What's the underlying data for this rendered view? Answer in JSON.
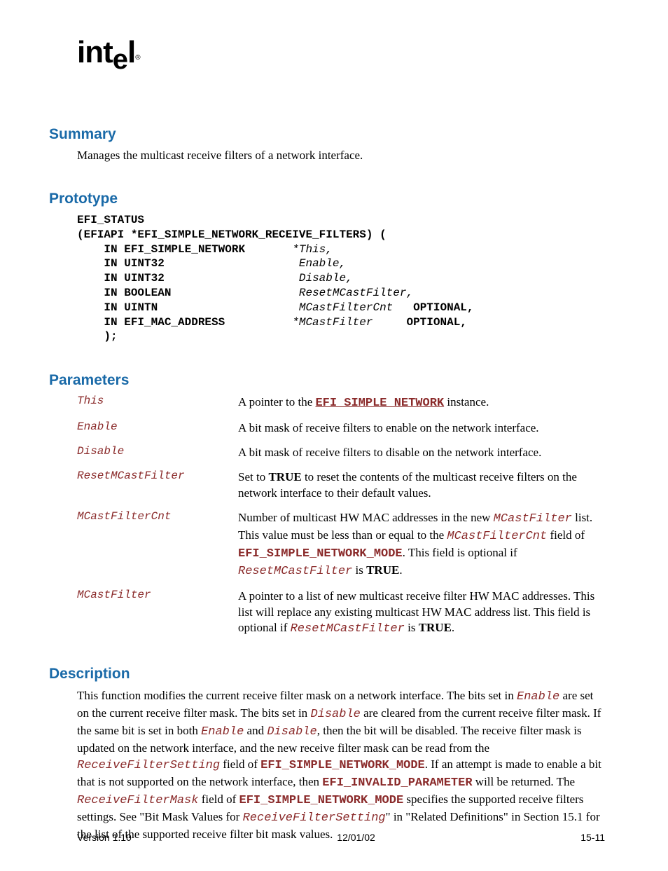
{
  "logo": "intel",
  "summary": {
    "heading": "Summary",
    "text": "Manages the multicast receive filters of a network interface."
  },
  "prototype": {
    "heading": "Prototype",
    "l1": "EFI_STATUS",
    "l2": "(EFIAPI *EFI_SIMPLE_NETWORK_RECEIVE_FILTERS) (",
    "r1a": "    IN EFI_SIMPLE_NETWORK       ",
    "r1b": "*This,",
    "r2a": "    IN UINT32                    ",
    "r2b": "Enable,",
    "r3a": "    IN UINT32                    ",
    "r3b": "Disable,",
    "r4a": "    IN BOOLEAN                   ",
    "r4b": "ResetMCastFilter,",
    "r5a": "    IN UINTN                     ",
    "r5b": "MCastFilterCnt",
    "r5c": "   OPTIONAL,",
    "r6a": "    IN EFI_MAC_ADDRESS          ",
    "r6b": "*MCastFilter",
    "r6c": "     OPTIONAL,",
    "r7": "    );"
  },
  "parameters": {
    "heading": "Parameters",
    "rows": [
      {
        "name": "This"
      },
      {
        "name": "Enable"
      },
      {
        "name": "Disable"
      },
      {
        "name": "ResetMCastFilter"
      },
      {
        "name": "MCastFilterCnt"
      },
      {
        "name": "MCastFilter"
      }
    ],
    "thisDesc": {
      "pre": "A pointer to the ",
      "link": "EFI_SIMPLE_NETWORK",
      "post": " instance."
    },
    "enableDesc": "A bit mask of receive filters to enable on the network interface.",
    "disableDesc": "A bit mask of receive filters to disable on the network interface.",
    "resetDesc": {
      "pre": "Set to ",
      "b1": "TRUE",
      "post": " to reset the contents of the multicast receive filters on the network interface to their default values."
    },
    "cntDesc": {
      "t1": "Number of multicast HW MAC addresses in the new ",
      "i1": "MCastFilter",
      "t2": " list.  This value must be less than or equal to the ",
      "i2": "MCastFilterCnt",
      "t3": " field of ",
      "b1": "EFI_SIMPLE_NETWORK_MODE",
      "t4": ". This field is optional if ",
      "i3": "ResetMCastFilter",
      "t5": " is ",
      "b2": "TRUE",
      "t6": "."
    },
    "filterDesc": {
      "t1": "A pointer to a list of new multicast receive filter HW MAC addresses.  This list will replace any existing multicast HW MAC address list.  This field is optional if ",
      "i1": "ResetMCastFilter",
      "t2": " is ",
      "b1": "TRUE",
      "t3": "."
    }
  },
  "description": {
    "heading": "Description",
    "t1": "This function modifies the current receive filter mask on a network interface.  The bits set in ",
    "i1": "Enable",
    "t2": " are set on the current receive filter mask.  The bits set in ",
    "i2": "Disable",
    "t3": " are cleared from the current receive filter mask.  If the same bit is set in both ",
    "i3": "Enable",
    "t4": " and ",
    "i4": "Disable",
    "t5": ", then the bit will be disabled.  The receive filter mask is updated on the network interface, and the new receive filter mask can be read from the ",
    "i5": "ReceiveFilterSetting",
    "t6": " field of ",
    "b1": "EFI_SIMPLE_NETWORK_MODE",
    "t7": ".  If an attempt is made to enable a bit that is not supported on the network interface, then ",
    "b2": "EFI_INVALID_PARAMETER",
    "t8": " will be returned.  The ",
    "i6": "ReceiveFilterMask",
    "t9": " field of ",
    "b3": "EFI_SIMPLE_NETWORK_MODE",
    "t10": " specifies the supported receive filters settings.  See \"Bit Mask Values for ",
    "i7": "ReceiveFilterSetting",
    "t11": "\" in \"Related Definitions\" in Section 15.1 for the list of the supported receive filter bit mask values."
  },
  "footer": {
    "left": "Version 1.10",
    "center": "12/01/02",
    "right": "15-11"
  }
}
